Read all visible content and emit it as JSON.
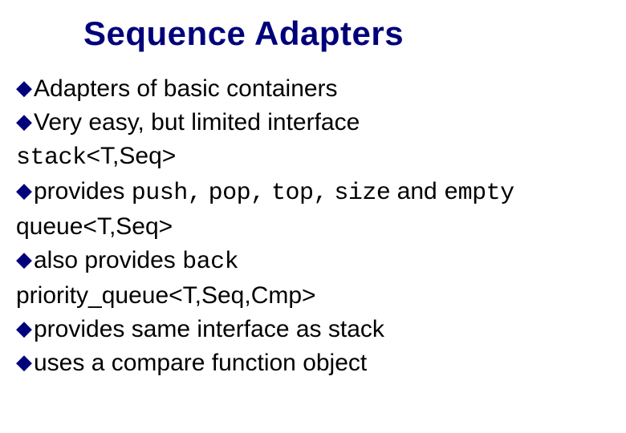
{
  "title": "Sequence Adapters",
  "lines": {
    "l1": {
      "lead": "Adapters",
      "rest": " of basic containers"
    },
    "l2": {
      "lead": "Very",
      "rest": " easy, but limited interface"
    },
    "l3": {
      "mono": "stack",
      "rest": "<T,Seq>"
    },
    "l4": {
      "lead": "provides ",
      "m1": "push,",
      "s1": " ",
      "m2": "pop,",
      "s2": " ",
      "m3": "top,",
      "s3": " ",
      "m4": "size",
      "mid": " and ",
      "m5": "empty"
    },
    "l5": "queue<T,Seq>",
    "l6": {
      "lead": "also",
      "rest": " provides ",
      "m": "back"
    },
    "l7": "priority_queue<T,Seq,Cmp>",
    "l8": {
      "lead": "provides",
      "rest": " same interface as stack"
    },
    "l9": {
      "lead": "uses",
      "rest": " a compare function object"
    }
  }
}
